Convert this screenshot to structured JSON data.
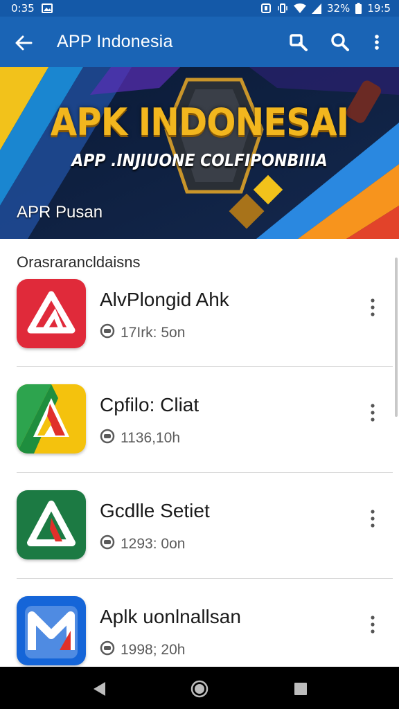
{
  "status_bar": {
    "time_left": "0:35",
    "battery_percent": "32%",
    "time_right": "19:5",
    "icons": [
      "image-icon",
      "nfc-icon",
      "vibrate-icon",
      "wifi-icon",
      "signal-icon",
      "battery-icon"
    ]
  },
  "app_bar": {
    "title": "APP Indonesia",
    "icons": [
      "back-arrow-icon",
      "search-alt-icon",
      "search-icon",
      "more-vert-icon"
    ]
  },
  "banner": {
    "title": "APK INDONESAI",
    "subtitle": "APP .INJIUONE COLFIPONBIIIA",
    "tag": "APR Pusan"
  },
  "list": {
    "section_title": "Orasrarancldaisns",
    "items": [
      {
        "name": "AlvPlongid Ahk",
        "meta": "17Irk: 5on",
        "icon": "red-a-logo-icon"
      },
      {
        "name": "Cpfilo: Cliat",
        "meta": "1136,10h",
        "icon": "green-yellow-a-logo-icon"
      },
      {
        "name": "Gcdlle Setiet",
        "meta": "1293: 0on",
        "icon": "green-a-logo-icon"
      },
      {
        "name": "Aplk uonlnallsan",
        "meta": "1998; 20h",
        "icon": "blue-m-logo-icon"
      }
    ]
  },
  "colors": {
    "primary": "#1a64b5",
    "status": "#1459a8",
    "banner_gold": "#f2b61e"
  }
}
